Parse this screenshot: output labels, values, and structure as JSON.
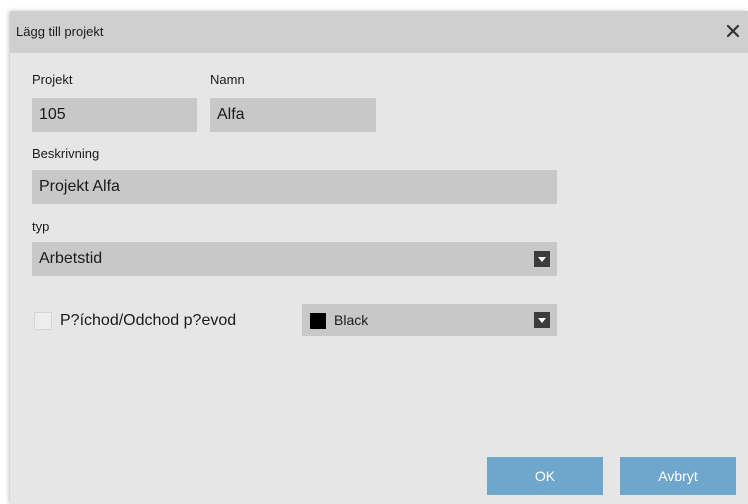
{
  "dialog": {
    "title": "Lägg till projekt",
    "close_glyph": "✕"
  },
  "fields": {
    "project_label": "Projekt",
    "project_value": "105",
    "name_label": "Namn",
    "name_value": "Alfa",
    "description_label": "Beskrivning",
    "description_value": "Projekt Alfa",
    "type_label": "typ",
    "type_value": "Arbetstid"
  },
  "options": {
    "checkbox_label": "P?íchod/Odchod p?evod",
    "checkbox_checked": false,
    "color_value": "Black",
    "color_hex": "#000000"
  },
  "buttons": {
    "ok_label": "OK",
    "cancel_label": "Avbryt"
  },
  "colors": {
    "button_bg": "#6fa6cc",
    "dialog_bg": "#e6e6e6",
    "titlebar_bg": "#cfcfcf",
    "field_bg": "#c8c8c8"
  }
}
